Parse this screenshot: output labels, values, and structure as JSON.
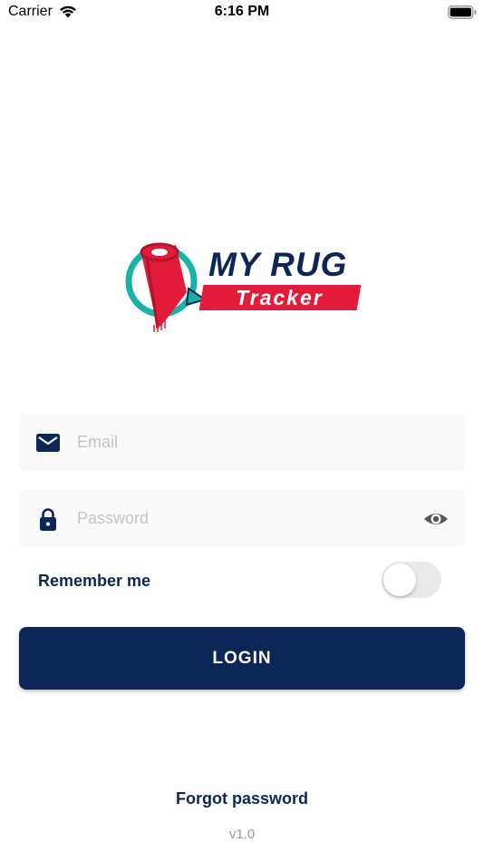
{
  "status_bar": {
    "carrier": "Carrier",
    "time": "6:16 PM",
    "wifi_icon": "wifi-icon",
    "battery_icon": "battery-full-icon"
  },
  "logo": {
    "line1": "MY RUG",
    "line2": "Tracker"
  },
  "form": {
    "email": {
      "placeholder": "Email",
      "value": "",
      "icon": "envelope-icon"
    },
    "password": {
      "placeholder": "Password",
      "value": "",
      "icon": "lock-icon",
      "reveal_icon": "eye-icon"
    },
    "remember_label": "Remember me",
    "remember_on": false,
    "login_label": "LOGIN"
  },
  "footer": {
    "forgot_label": "Forgot password",
    "version": "v1.0"
  },
  "colors": {
    "primary": "#0c2757",
    "accent_red": "#e31b3a",
    "accent_teal": "#19b3a6",
    "field_bg": "#f9f9f9",
    "placeholder": "#c4c4c4"
  }
}
